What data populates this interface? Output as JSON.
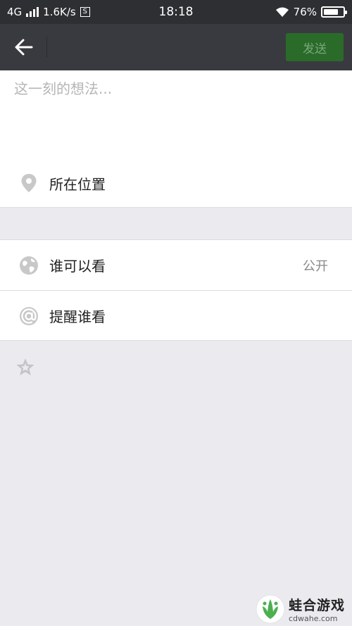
{
  "status_bar": {
    "network": "4G",
    "speed": "1.6K/s",
    "sim_label": "S",
    "time": "18:18",
    "battery_text": "76%",
    "battery_level": 0.76
  },
  "navbar": {
    "back_icon": "arrow-left-icon",
    "send_label": "发送"
  },
  "compose": {
    "placeholder": "这一刻的想法...",
    "value": ""
  },
  "location": {
    "icon": "location-pin-icon",
    "label": "所在位置"
  },
  "visibility": {
    "icon": "globe-icon",
    "label": "谁可以看",
    "value": "公开"
  },
  "mention": {
    "icon": "at-icon",
    "label": "提醒谁看"
  },
  "star_icon": "star-icon",
  "watermark": {
    "title": "蛙合游戏",
    "url": "cdwahe.com"
  },
  "colors": {
    "navbar": "#393a3f",
    "status_bar": "#2e2f33",
    "send_button": "#2a6b2a",
    "background": "#ebeaef"
  }
}
